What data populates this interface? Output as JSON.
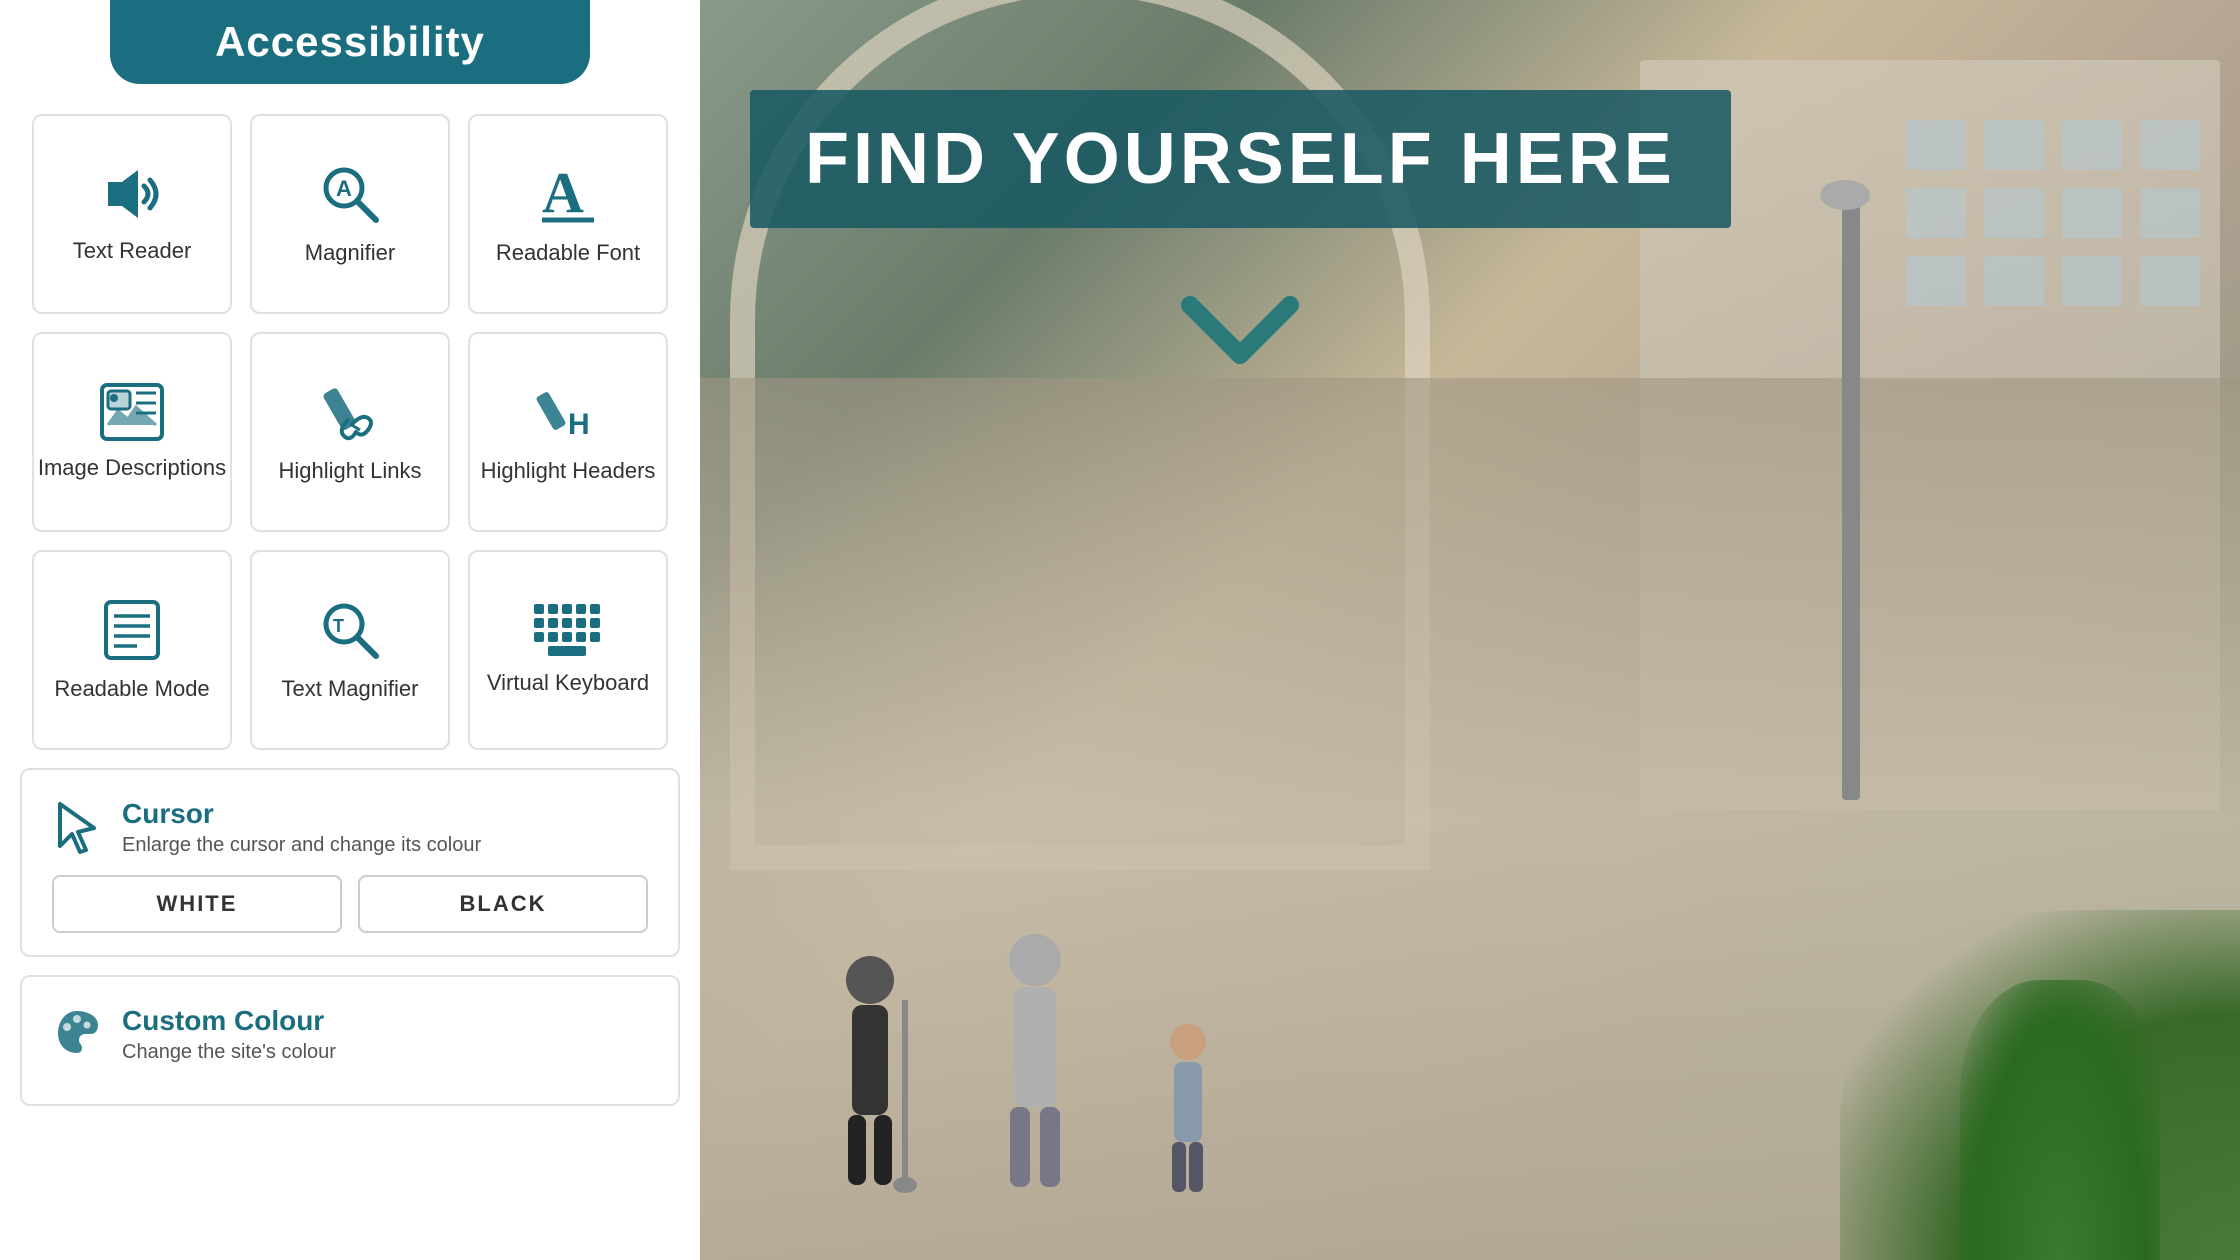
{
  "header": {
    "title": "Accessibility"
  },
  "grid_rows": [
    [
      {
        "id": "text-reader",
        "label": "Text Reader",
        "icon": "speaker"
      },
      {
        "id": "magnifier",
        "label": "Magnifier",
        "icon": "magnifier-a"
      },
      {
        "id": "readable-font",
        "label": "Readable Font",
        "icon": "font-a"
      }
    ],
    [
      {
        "id": "image-descriptions",
        "label": "Image Descriptions",
        "icon": "image"
      },
      {
        "id": "highlight-links",
        "label": "Highlight Links",
        "icon": "highlight-link"
      },
      {
        "id": "highlight-headers",
        "label": "Highlight Headers",
        "icon": "highlight-header"
      }
    ],
    [
      {
        "id": "readable-mode",
        "label": "Readable Mode",
        "icon": "readable-mode"
      },
      {
        "id": "text-magnifier",
        "label": "Text Magnifier",
        "icon": "text-magnifier"
      },
      {
        "id": "virtual-keyboard",
        "label": "Virtual Keyboard",
        "icon": "keyboard"
      }
    ]
  ],
  "cursor_section": {
    "title": "Cursor",
    "description": "Enlarge the cursor and change its colour",
    "buttons": [
      "WHITE",
      "BLACK"
    ]
  },
  "custom_colour_section": {
    "title": "Custom Colour",
    "description": "Change the site's colour"
  },
  "right_panel": {
    "banner_text": "FIND YOURSELF HERE"
  }
}
